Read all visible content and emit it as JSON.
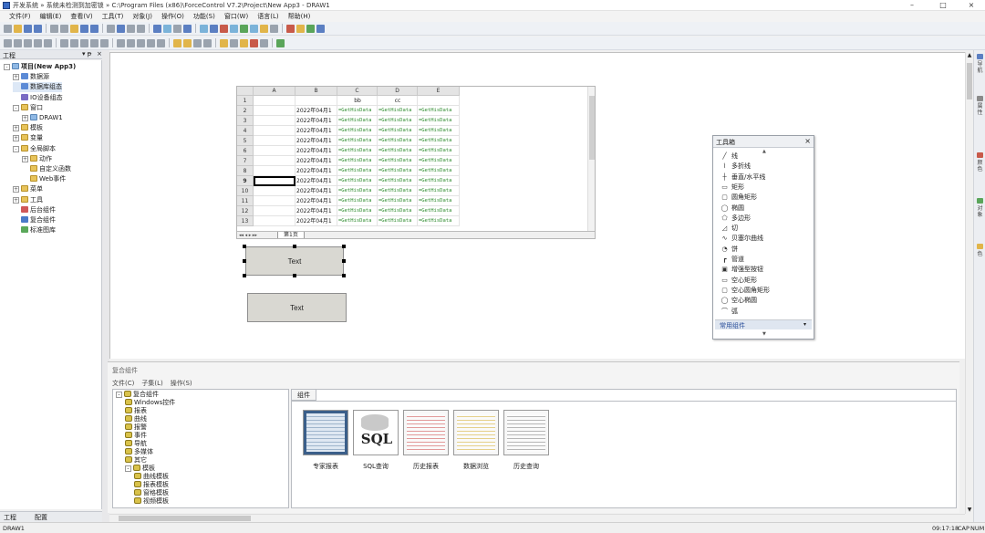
{
  "window": {
    "title": "开发系统 » 系统未检测到加密锁 » C:\\Program Files (x86)\\ForceControl V7.2\\Project\\New App3 - DRAW1",
    "minimize": "–",
    "maximize": "□",
    "close": "×"
  },
  "menu": [
    "文件(F)",
    "编辑(E)",
    "查看(V)",
    "工具(T)",
    "对象(J)",
    "操作(O)",
    "功能(S)",
    "窗口(W)",
    "语言(L)",
    "帮助(H)"
  ],
  "project_panel": {
    "title": "工程",
    "pin": "▾ ᵽ",
    "close": "×",
    "tree": [
      {
        "label": "项目(New App3)",
        "level": 0,
        "toggle": "-",
        "icon": "win",
        "bold": true
      },
      {
        "label": "数据源",
        "level": 1,
        "toggle": "+",
        "icon": "db"
      },
      {
        "label": "数据库组态",
        "level": 1,
        "toggle": "",
        "icon": "db",
        "selected": true
      },
      {
        "label": "IO设备组态",
        "level": 1,
        "toggle": "",
        "icon": "io"
      },
      {
        "label": "窗口",
        "level": 1,
        "toggle": "-",
        "icon": "folder"
      },
      {
        "label": "DRAW1",
        "level": 2,
        "toggle": "+",
        "icon": "win"
      },
      {
        "label": "模板",
        "level": 1,
        "toggle": "+",
        "icon": "folder"
      },
      {
        "label": "变量",
        "level": 1,
        "toggle": "+",
        "icon": "folder"
      },
      {
        "label": "全局脚本",
        "level": 1,
        "toggle": "-",
        "icon": "folder"
      },
      {
        "label": "动作",
        "level": 2,
        "toggle": "+",
        "icon": "folder"
      },
      {
        "label": "自定义函数",
        "level": 2,
        "toggle": "",
        "icon": "folder"
      },
      {
        "label": "Web事件",
        "level": 2,
        "toggle": "",
        "icon": "folder"
      },
      {
        "label": "菜单",
        "level": 1,
        "toggle": "+",
        "icon": "folder"
      },
      {
        "label": "工具",
        "level": 1,
        "toggle": "+",
        "icon": "folder"
      },
      {
        "label": "后台组件",
        "level": 1,
        "toggle": "",
        "icon": "red"
      },
      {
        "label": "复合组件",
        "level": 1,
        "toggle": "",
        "icon": "blue"
      },
      {
        "label": "标准图库",
        "level": 1,
        "toggle": "",
        "icon": "green"
      }
    ],
    "tabs": [
      "工程",
      "配置"
    ]
  },
  "right_dock": [
    "导航",
    "属性",
    "颜色",
    "对象",
    "色"
  ],
  "spreadsheet": {
    "columns": [
      "",
      "A",
      "B",
      "C",
      "D",
      "E"
    ],
    "header_row": [
      "",
      "",
      "bb",
      "cc",
      ""
    ],
    "row_numbers": [
      "1",
      "2",
      "3",
      "4",
      "5",
      "6",
      "7",
      "8",
      "9",
      "10",
      "11",
      "12",
      "13"
    ],
    "date_cell": "2022年04月1",
    "formula_cell": "=GetHisData",
    "sheet_tab": "第1页",
    "nav": "◂◂ ◂ ▸ ▸▸"
  },
  "canvas_buttons": [
    {
      "label": "Text",
      "selected": true
    },
    {
      "label": "Text",
      "selected": false
    }
  ],
  "toolbox": {
    "title": "工具箱",
    "close": "×",
    "items": [
      {
        "glyph": "╱",
        "label": "线"
      },
      {
        "glyph": "⌇",
        "label": "多折线"
      },
      {
        "glyph": "┼",
        "label": "垂直/水平线"
      },
      {
        "glyph": "▭",
        "label": "矩形"
      },
      {
        "glyph": "▢",
        "label": "圆角矩形"
      },
      {
        "glyph": "◯",
        "label": "椭圆"
      },
      {
        "glyph": "⬠",
        "label": "多边形"
      },
      {
        "glyph": "◿",
        "label": "切"
      },
      {
        "glyph": "∿",
        "label": "贝塞尔曲线"
      },
      {
        "glyph": "◔",
        "label": "饼"
      },
      {
        "glyph": "┏",
        "label": "管道"
      },
      {
        "glyph": "▣",
        "label": "增强型按钮"
      },
      {
        "glyph": "▭",
        "label": "空心矩形"
      },
      {
        "glyph": "▢",
        "label": "空心圆角矩形"
      },
      {
        "glyph": "◯",
        "label": "空心椭圆"
      },
      {
        "glyph": "⌒",
        "label": "弧"
      }
    ],
    "category": "常用组件",
    "category_arrow": "▾"
  },
  "composite_panel": {
    "title": "复合组件",
    "menu": [
      "文件(C)",
      "子集(L)",
      "操作(S)"
    ],
    "tree": [
      {
        "label": "复合组件",
        "level": 0,
        "toggle": "-"
      },
      {
        "label": "Windows控件",
        "level": 1
      },
      {
        "label": "报表",
        "level": 1
      },
      {
        "label": "曲线",
        "level": 1
      },
      {
        "label": "报警",
        "level": 1
      },
      {
        "label": "事件",
        "level": 1
      },
      {
        "label": "导航",
        "level": 1
      },
      {
        "label": "多媒体",
        "level": 1
      },
      {
        "label": "其它",
        "level": 1
      },
      {
        "label": "模板",
        "level": 1,
        "toggle": "-"
      },
      {
        "label": "曲线模板",
        "level": 2
      },
      {
        "label": "报表模板",
        "level": 2
      },
      {
        "label": "窗格模板",
        "level": 2
      },
      {
        "label": "视频模板",
        "level": 2
      }
    ],
    "tab": "组件",
    "items": [
      {
        "label": "专家报表",
        "kind": "report"
      },
      {
        "label": "SQL查询",
        "kind": "sql",
        "text": "SQL"
      },
      {
        "label": "历史报表",
        "kind": "hist"
      },
      {
        "label": "数据浏览",
        "kind": "browse"
      },
      {
        "label": "历史查询",
        "kind": "query"
      }
    ]
  },
  "status": {
    "left": "DRAW1",
    "time": "09:17:18",
    "cap": "CAP",
    "num": "NUM"
  }
}
